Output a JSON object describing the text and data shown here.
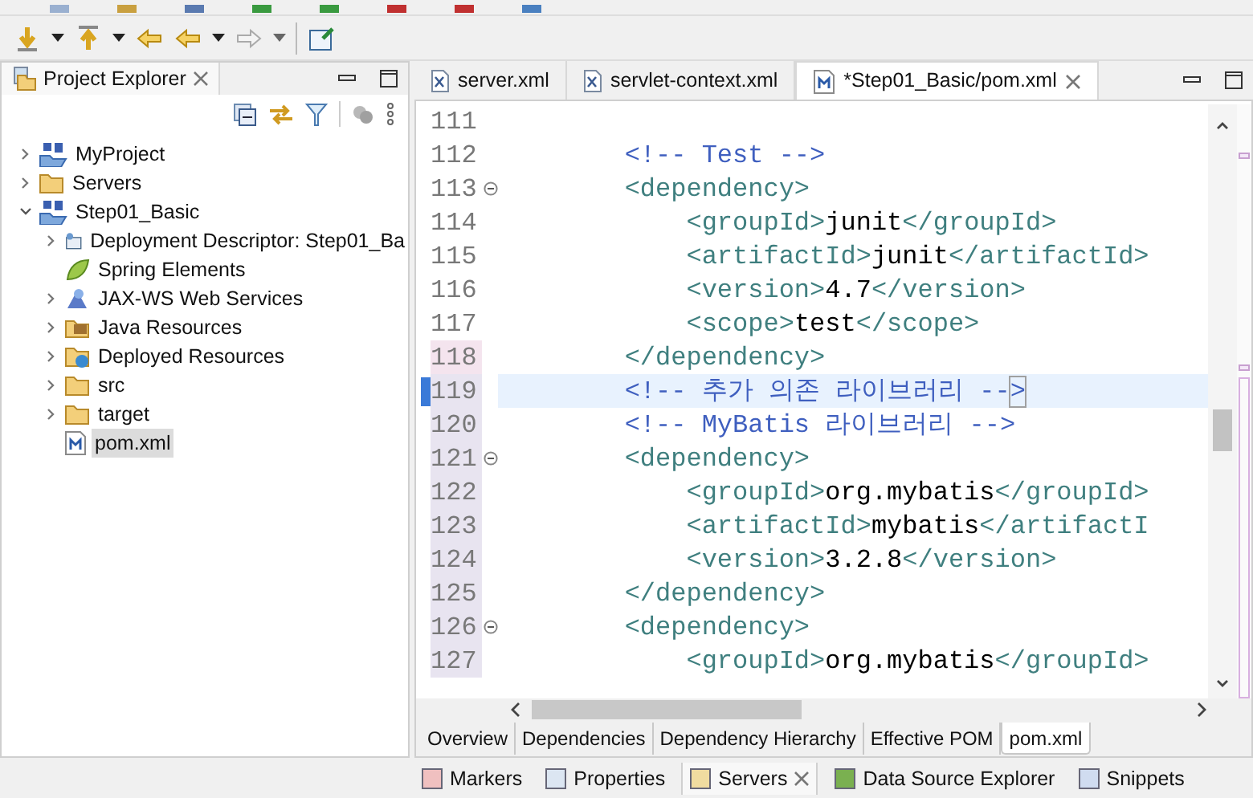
{
  "explorer": {
    "title": "Project Explorer",
    "tree": [
      {
        "label": "MyProject",
        "kind": "maven",
        "expanded": false,
        "selected": false
      },
      {
        "label": "Servers",
        "kind": "folder",
        "expanded": false,
        "selected": false
      },
      {
        "label": "Step01_Basic",
        "kind": "maven",
        "expanded": true,
        "selected": false,
        "children": [
          {
            "label": "Deployment Descriptor: Step01_Ba",
            "kind": "descriptor",
            "expanded": false,
            "selected": false
          },
          {
            "label": "Spring Elements",
            "kind": "leaf",
            "selected": false
          },
          {
            "label": "JAX-WS Web Services",
            "kind": "webservice",
            "expanded": false,
            "selected": false
          },
          {
            "label": "Java Resources",
            "kind": "javares",
            "expanded": false,
            "selected": false
          },
          {
            "label": "Deployed Resources",
            "kind": "deployed",
            "expanded": false,
            "selected": false
          },
          {
            "label": "src",
            "kind": "folder",
            "expanded": false,
            "selected": false
          },
          {
            "label": "target",
            "kind": "folder",
            "expanded": false,
            "selected": false
          },
          {
            "label": "pom.xml",
            "kind": "pom",
            "selected": true
          }
        ]
      }
    ]
  },
  "editor_tabs": [
    {
      "label": "server.xml",
      "kind": "xml",
      "selected": false
    },
    {
      "label": "servlet-context.xml",
      "kind": "xml",
      "selected": false
    },
    {
      "label": "*Step01_Basic/pom.xml",
      "kind": "pom",
      "selected": true
    }
  ],
  "code_lines": [
    {
      "number": "111",
      "fold": false,
      "marked": false,
      "current": false
    },
    {
      "number": "112",
      "fold": false,
      "marked": false,
      "current": false,
      "tokens": [
        {
          "kind": "comment",
          "text": "        <!-- Test -->"
        }
      ]
    },
    {
      "number": "113",
      "fold": true,
      "marked": false,
      "current": false,
      "tokens": [
        {
          "kind": "tag",
          "text": "        <dependency>"
        }
      ]
    },
    {
      "number": "114",
      "fold": false,
      "marked": false,
      "current": false,
      "tokens": [
        {
          "kind": "tag",
          "text": "            <groupId>"
        },
        {
          "kind": "text",
          "text": "junit"
        },
        {
          "kind": "tag",
          "text": "</groupId>"
        }
      ]
    },
    {
      "number": "115",
      "fold": false,
      "marked": false,
      "current": false,
      "tokens": [
        {
          "kind": "tag",
          "text": "            <artifactId>"
        },
        {
          "kind": "text",
          "text": "junit"
        },
        {
          "kind": "tag",
          "text": "</artifactId>"
        }
      ]
    },
    {
      "number": "116",
      "fold": false,
      "marked": false,
      "current": false,
      "tokens": [
        {
          "kind": "tag",
          "text": "            <version>"
        },
        {
          "kind": "text",
          "text": "4.7"
        },
        {
          "kind": "tag",
          "text": "</version>"
        }
      ]
    },
    {
      "number": "117",
      "fold": false,
      "marked": false,
      "current": false,
      "tokens": [
        {
          "kind": "tag",
          "text": "            <scope>"
        },
        {
          "kind": "text",
          "text": "test"
        },
        {
          "kind": "tag",
          "text": "</scope>"
        }
      ]
    },
    {
      "number": "118",
      "fold": false,
      "marked": true,
      "current": false,
      "tokens": [
        {
          "kind": "tag",
          "text": "        </dependency>"
        }
      ]
    },
    {
      "number": "119",
      "fold": false,
      "marked": true,
      "current": true,
      "tokens": [
        {
          "kind": "comment",
          "text": "        <!-- 추가 의존 라이브러리 --"
        },
        {
          "kind": "bracket",
          "text": ">"
        }
      ]
    },
    {
      "number": "120",
      "fold": false,
      "marked": true,
      "current": false,
      "tokens": [
        {
          "kind": "comment",
          "text": "        <!-- MyBatis 라이브러리 -->"
        }
      ]
    },
    {
      "number": "121",
      "fold": true,
      "marked": true,
      "current": false,
      "tokens": [
        {
          "kind": "tag",
          "text": "        <dependency>"
        }
      ]
    },
    {
      "number": "122",
      "fold": false,
      "marked": true,
      "current": false,
      "tokens": [
        {
          "kind": "tag",
          "text": "            <groupId>"
        },
        {
          "kind": "text",
          "text": "org.mybatis"
        },
        {
          "kind": "tag",
          "text": "</groupId>"
        }
      ]
    },
    {
      "number": "123",
      "fold": false,
      "marked": true,
      "current": false,
      "tokens": [
        {
          "kind": "tag",
          "text": "            <artifactId>"
        },
        {
          "kind": "text",
          "text": "mybatis"
        },
        {
          "kind": "tag",
          "text": "</artifactI"
        }
      ]
    },
    {
      "number": "124",
      "fold": false,
      "marked": true,
      "current": false,
      "tokens": [
        {
          "kind": "tag",
          "text": "            <version>"
        },
        {
          "kind": "text",
          "text": "3.2.8"
        },
        {
          "kind": "tag",
          "text": "</version>"
        }
      ]
    },
    {
      "number": "125",
      "fold": false,
      "marked": true,
      "current": false,
      "tokens": [
        {
          "kind": "tag",
          "text": "        </dependency>"
        }
      ]
    },
    {
      "number": "126",
      "fold": true,
      "marked": true,
      "current": false,
      "tokens": [
        {
          "kind": "tag",
          "text": "        <dependency>"
        }
      ]
    },
    {
      "number": "127",
      "fold": false,
      "marked": true,
      "current": false,
      "tokens": [
        {
          "kind": "tag",
          "text": "            <groupId>"
        },
        {
          "kind": "text",
          "text": "org.mybatis"
        },
        {
          "kind": "tag",
          "text": "</groupId>"
        }
      ]
    }
  ],
  "page_tabs": [
    {
      "label": "Overview",
      "selected": false
    },
    {
      "label": "Dependencies",
      "selected": false
    },
    {
      "label": "Dependency Hierarchy",
      "selected": false
    },
    {
      "label": "Effective POM",
      "selected": false
    },
    {
      "label": "pom.xml",
      "selected": true
    }
  ],
  "bottom_tabs": [
    {
      "label": "Markers",
      "selected": false
    },
    {
      "label": "Properties",
      "selected": false
    },
    {
      "label": "Servers",
      "selected": true
    },
    {
      "label": "Data Source Explorer",
      "selected": false
    },
    {
      "label": "Snippets",
      "selected": false
    }
  ]
}
